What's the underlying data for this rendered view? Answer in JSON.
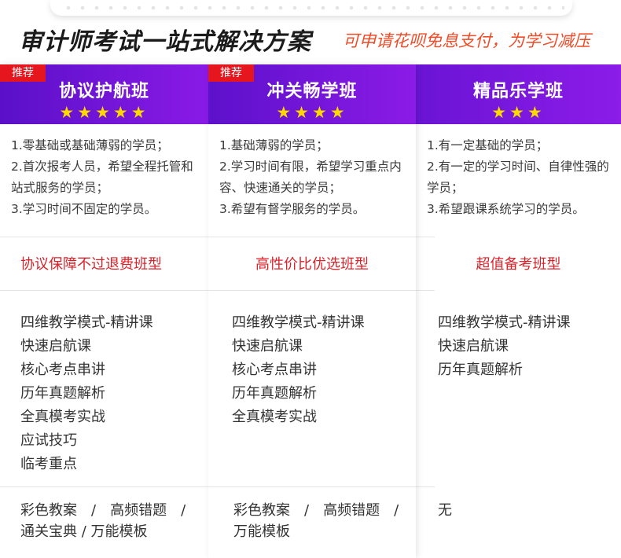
{
  "header": {
    "title": "审计师考试一站式解决方案",
    "subtitle": "可申请花呗免息支付，为学习减压"
  },
  "plans": [
    {
      "badge": "推荐",
      "name": "协议护航班",
      "stars": "★★★★★",
      "rating": 5,
      "audience": [
        "1.零基础或基础薄弱的学员；",
        "2.首次报考人员，希望全程托管和　站式服务的学员；",
        "3.学习时间不固定的学员。"
      ],
      "tagline": "协议保障不过退费班型",
      "courses": [
        "四维教学模式-精讲课",
        "快速启航课",
        "核心考点串讲",
        "历年真题解析",
        "全真模考实战",
        "应试技巧",
        "临考重点"
      ],
      "materials": "彩色教案　/　高频错题　/　通关宝典 / 万能模板"
    },
    {
      "badge": "推荐",
      "name": "冲关畅学班",
      "stars": "★★★★",
      "rating": 4,
      "audience": [
        "1.基础薄弱的学员；",
        "2.学习时间有限，希望学习重点内容、快速通关的学员；",
        "3.希望有督学服务的学员。"
      ],
      "tagline": "高性价比优选班型",
      "courses": [
        "四维教学模式-精讲课",
        "快速启航课",
        "核心考点串讲",
        "历年真题解析",
        "全真模考实战"
      ],
      "materials": "彩色教案　/　高频错题　/　万能模板"
    },
    {
      "badge": "",
      "name": "精品乐学班",
      "stars": "★★★",
      "rating": 3,
      "audience": [
        "1.有一定基础的学员；",
        "2.有一定的学习时间、自律性强的学员；",
        "3.希望跟课系统学习的学员。"
      ],
      "tagline": "超值备考班型",
      "courses": [
        "四维教学模式-精讲课",
        "快速启航课",
        "历年真题解析"
      ],
      "materials": "无"
    }
  ],
  "colors": {
    "header_purple": "#6a14d4",
    "badge_red": "#e5161d",
    "star_yellow": "#ffd800",
    "tagline_red": "#d9232b",
    "subtitle_orange": "#ef4b27"
  }
}
